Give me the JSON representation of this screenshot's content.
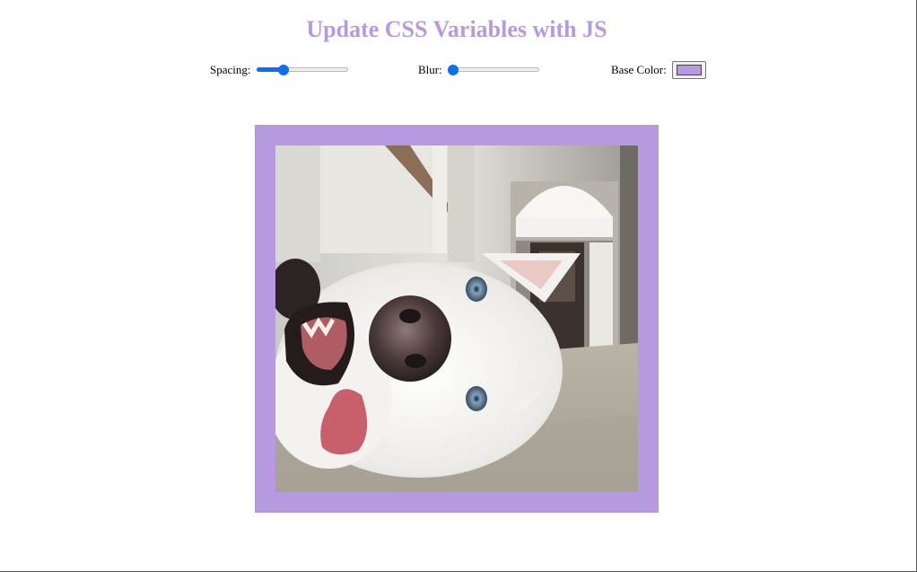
{
  "header": {
    "title": "Update CSS Variables with JS"
  },
  "controls": {
    "spacing": {
      "label": "Spacing:",
      "value": 10,
      "min": 10,
      "max": 200,
      "fraction": 0.3
    },
    "blur": {
      "label": "Blur:",
      "value": 0,
      "min": 0,
      "max": 25,
      "fraction": 0.0
    },
    "base_color": {
      "label": "Base Color:",
      "value": "#b69ae0"
    }
  },
  "image": {
    "subject": "husky-dog-photo"
  },
  "colors": {
    "accent": "#b69ae0",
    "slider": "#0b6ff5"
  }
}
